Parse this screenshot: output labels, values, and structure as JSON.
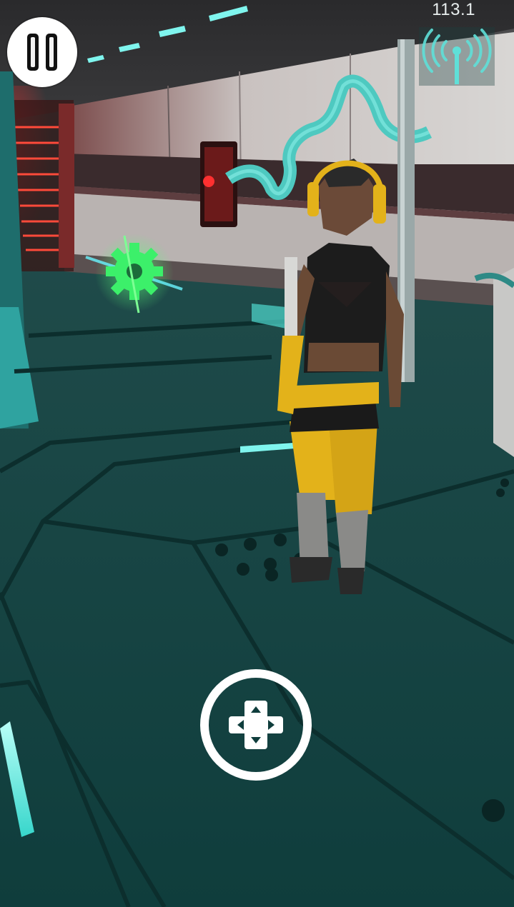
{
  "hud": {
    "fps_value": "113.1"
  },
  "icons": {
    "pause": "pause-icon",
    "signal": "signal-tower-icon",
    "dpad": "dpad-move-icon",
    "gear_pickup": "gear-icon"
  },
  "colors": {
    "accent_cyan": "#5fe0d8",
    "laser_red": "#ff2a2a",
    "gear_green": "#3cf06a",
    "suit_yellow": "#e3b21a"
  }
}
